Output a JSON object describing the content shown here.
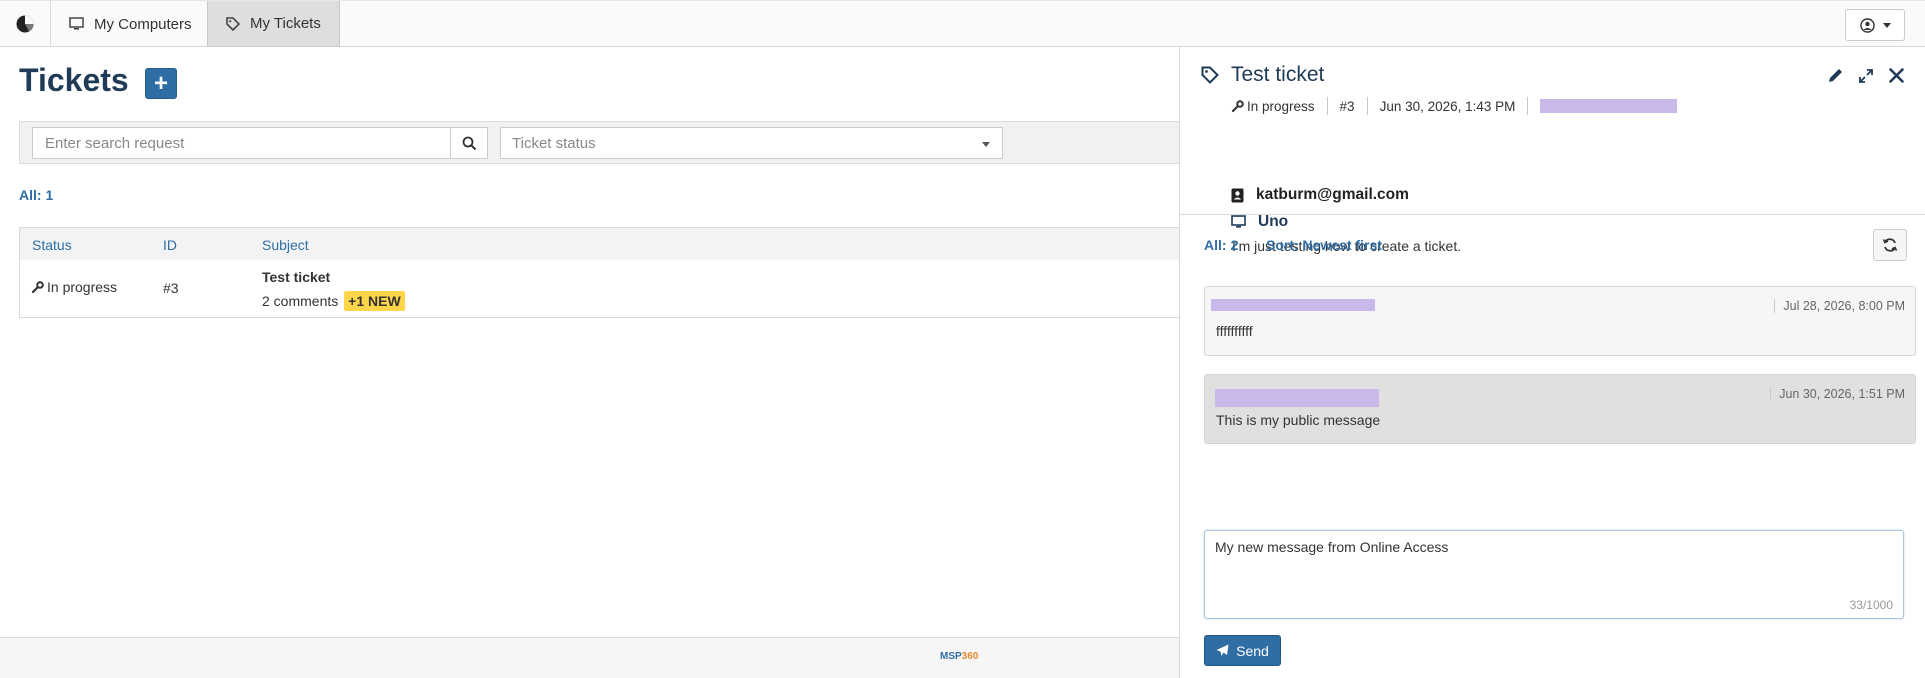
{
  "nav": {
    "tabs": [
      {
        "label": "My Computers",
        "icon": "monitor-icon"
      },
      {
        "label": "My Tickets",
        "icon": "tag-icon"
      }
    ]
  },
  "main": {
    "title": "Tickets",
    "add_label": "+",
    "search_placeholder": "Enter search request",
    "status_placeholder": "Ticket status",
    "count_label": "All: 1",
    "columns": [
      "Status",
      "ID",
      "Subject"
    ],
    "rows": [
      {
        "status": "In progress",
        "id": "#3",
        "subject": "Test ticket",
        "comments": "2 comments",
        "new_badge": "+1 NEW"
      }
    ]
  },
  "footer": {
    "brand_a": "MSP",
    "brand_b": "360"
  },
  "panel": {
    "title": "Test ticket",
    "status": "In progress",
    "id": "#3",
    "created": "Jun 30, 2026, 1:43 PM",
    "email": "katburm@gmail.com",
    "computer": "Uno",
    "description": "I'm just testing how to create a ticket.",
    "comments_count": "All: 2",
    "sort_label": "Sort: Newest first",
    "comments": [
      {
        "date": "Jul 28, 2026, 8:00 PM",
        "text": "ffffffffff"
      },
      {
        "date": "Jun 30, 2026, 1:51 PM",
        "text": "This is my public message"
      }
    ],
    "new_message": "My new message from Online Access",
    "char_count": "33/1000",
    "send_label": "Send"
  }
}
